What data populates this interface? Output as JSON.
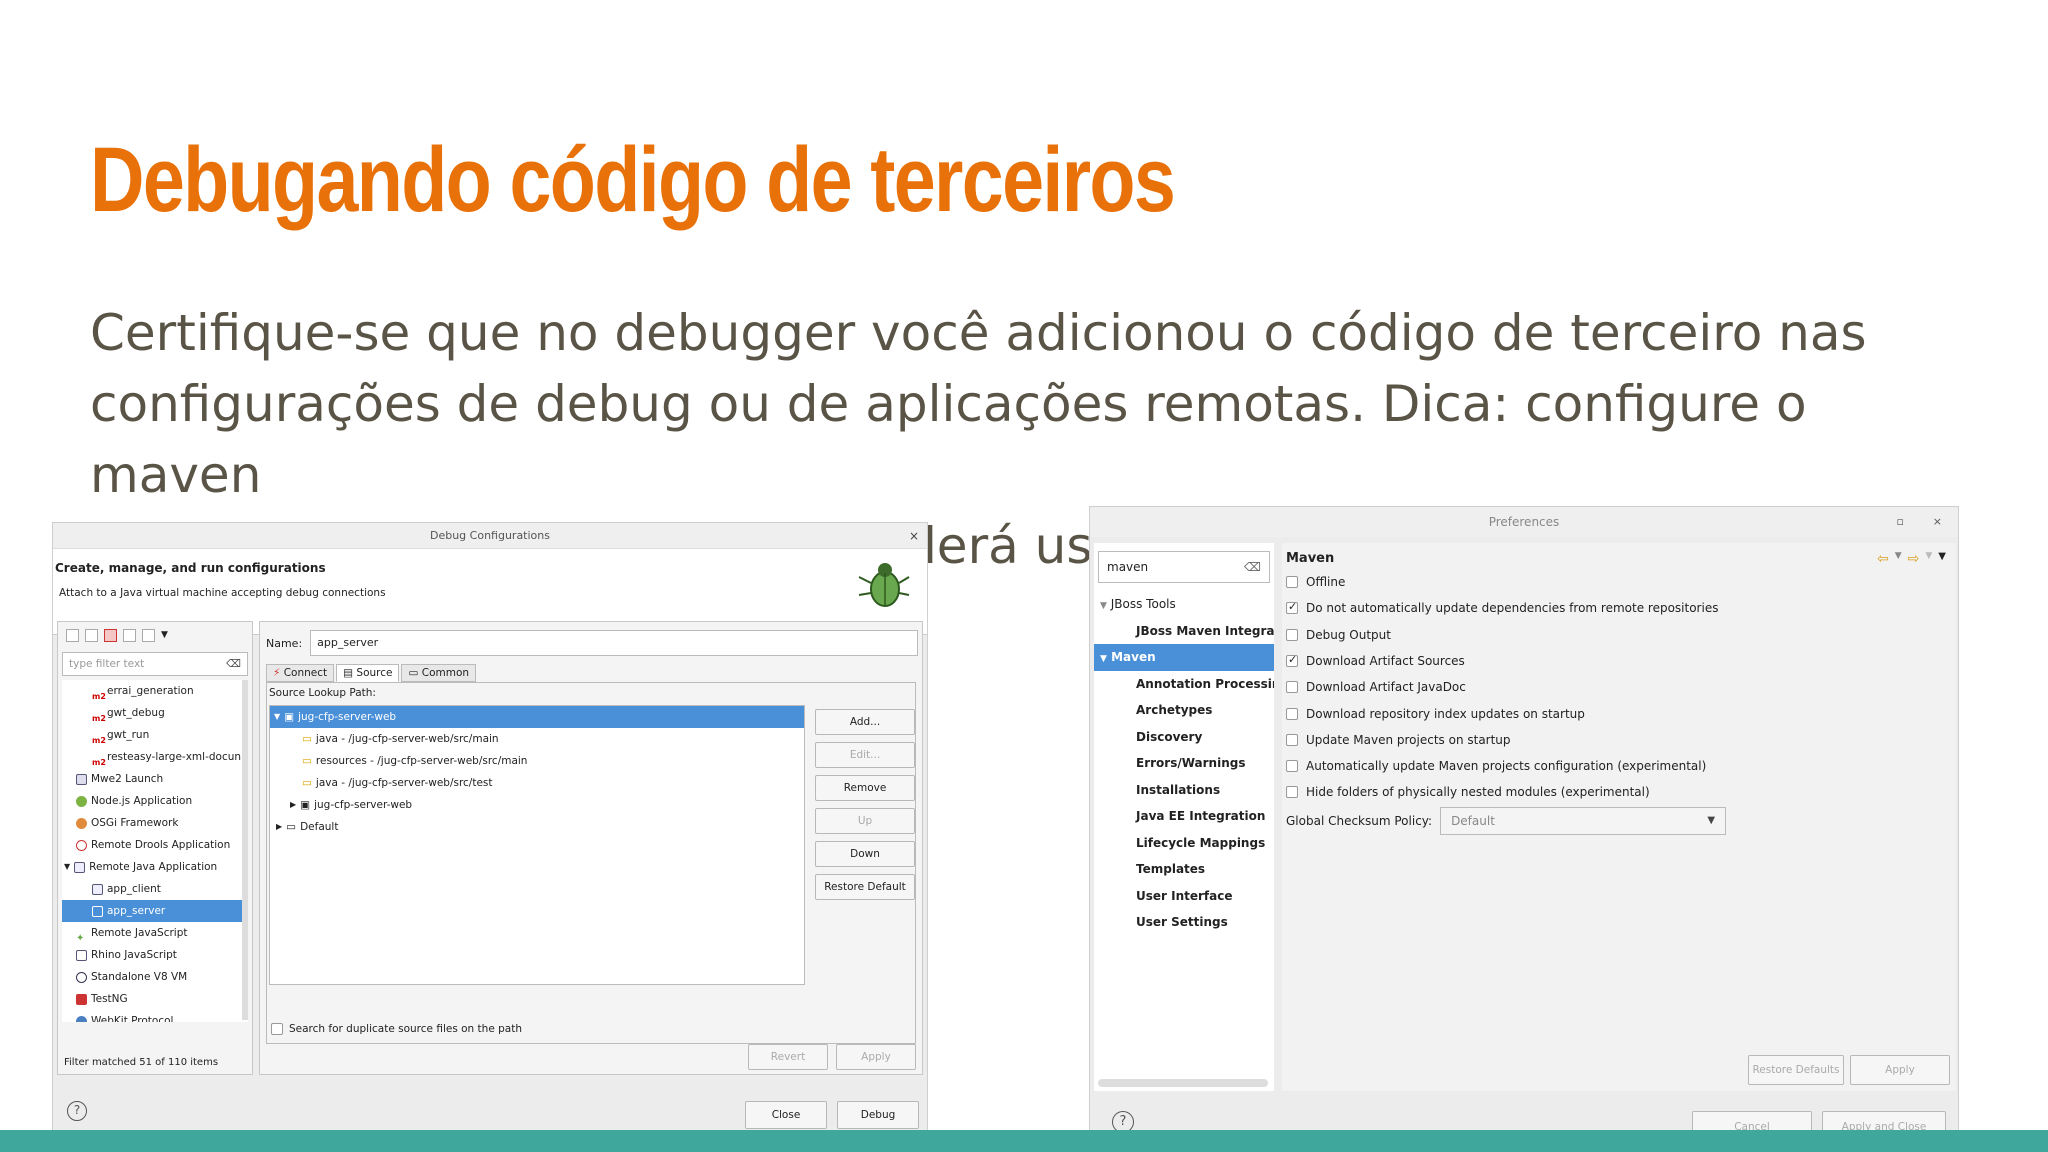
{
  "slide": {
    "title": "Debugando código de terceiros",
    "body_line1": "Certifique-se que no debugger você adicionou o código de terceiro nas",
    "body_line2": "configurações de debug ou de aplicações remotas. Dica: configure o maven",
    "body_line3": "para baixar código, pois você poderá usar no debug depois"
  },
  "debug_window": {
    "title": "Debug Configurations",
    "close": "×",
    "header_title": "Create, manage, and run configurations",
    "header_subtitle": "Attach to a Java virtual machine accepting debug connections",
    "filter_placeholder": "type filter text",
    "tree": [
      "errai_generation",
      "gwt_debug",
      "gwt_run",
      "resteasy-large-xml-docun",
      "Mwe2 Launch",
      "Node.js Application",
      "OSGi Framework",
      "Remote Drools Application",
      "Remote Java Application",
      "app_client",
      "app_server",
      "Remote JavaScript",
      "Rhino JavaScript",
      "Standalone V8 VM",
      "TestNG",
      "WebKit Protocol"
    ],
    "filter_status": "Filter matched 51 of 110 items",
    "name_label": "Name:",
    "name_value": "app_server",
    "tabs": [
      "Connect",
      "Source",
      "Common"
    ],
    "source_lookup_label": "Source Lookup Path:",
    "source_items": [
      "jug-cfp-server-web",
      "java - /jug-cfp-server-web/src/main",
      "resources - /jug-cfp-server-web/src/main",
      "java - /jug-cfp-server-web/src/test",
      "jug-cfp-server-web",
      "Default"
    ],
    "side_buttons": [
      "Add...",
      "Edit...",
      "Remove",
      "Up",
      "Down",
      "Restore Default"
    ],
    "duplicate_label": "Search for duplicate source files on the path",
    "revert": "Revert",
    "apply": "Apply",
    "help": "?",
    "close_btn": "Close",
    "debug_btn": "Debug"
  },
  "pref_window": {
    "title": "Preferences",
    "search_value": "maven",
    "tree": [
      "JBoss Tools",
      "JBoss Maven Integra",
      "Maven",
      "Annotation Processir",
      "Archetypes",
      "Discovery",
      "Errors/Warnings",
      "Installations",
      "Java EE Integration",
      "Lifecycle Mappings",
      "Templates",
      "User Interface",
      "User Settings"
    ],
    "section_title": "Maven",
    "options": [
      {
        "label": "Offline",
        "checked": false
      },
      {
        "label": "Do not automatically update dependencies from remote repositories",
        "checked": true
      },
      {
        "label": "Debug Output",
        "checked": false
      },
      {
        "label": "Download Artifact Sources",
        "checked": true
      },
      {
        "label": "Download Artifact JavaDoc",
        "checked": false
      },
      {
        "label": "Download repository index updates on startup",
        "checked": false
      },
      {
        "label": "Update Maven projects on startup",
        "checked": false
      },
      {
        "label": "Automatically update Maven projects configuration (experimental)",
        "checked": false
      },
      {
        "label": "Hide folders of physically nested modules (experimental)",
        "checked": false
      }
    ],
    "policy_label": "Global Checksum Policy:",
    "policy_value": "Default",
    "restore_defaults": "Restore Defaults",
    "apply": "Apply",
    "help": "?",
    "cancel": "Cancel",
    "apply_close": "Apply and Close"
  },
  "colors": {
    "title_orange": "#e8710a",
    "body_text": "#595446",
    "selection_blue": "#4a90d9",
    "footer_teal": "#3fa79b"
  }
}
